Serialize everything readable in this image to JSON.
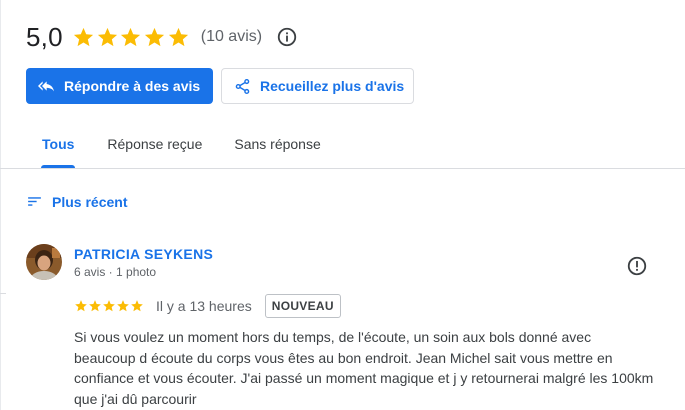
{
  "summary": {
    "score": "5,0",
    "stars": 5,
    "count_text": "(10 avis)",
    "star_color": "#fbbc04"
  },
  "actions": {
    "reply_label": "Répondre à des avis",
    "collect_label": "Recueillez plus d'avis"
  },
  "tabs": [
    {
      "label": "Tous",
      "active": true
    },
    {
      "label": "Réponse reçue",
      "active": false
    },
    {
      "label": "Sans réponse",
      "active": false
    }
  ],
  "sort": {
    "label": "Plus récent"
  },
  "review": {
    "name": "PATRICIA SEYKENS",
    "meta": "6 avis · 1 photo",
    "rating": 5,
    "time": "Il y a 13 heures",
    "badge": "NOUVEAU",
    "text": "Si vous voulez un moment hors du temps, de l'écoute, un soin aux bols donné avec beaucoup d écoute du corps vous êtes au bon endroit. Jean Michel sait vous mettre en confiance et vous écouter. J'ai passé un moment magique et j y retournerai malgré les 100km que j'ai dû parcourir"
  },
  "colors": {
    "accent": "#1a73e8",
    "text": "#3c4043",
    "muted": "#5f6368"
  }
}
